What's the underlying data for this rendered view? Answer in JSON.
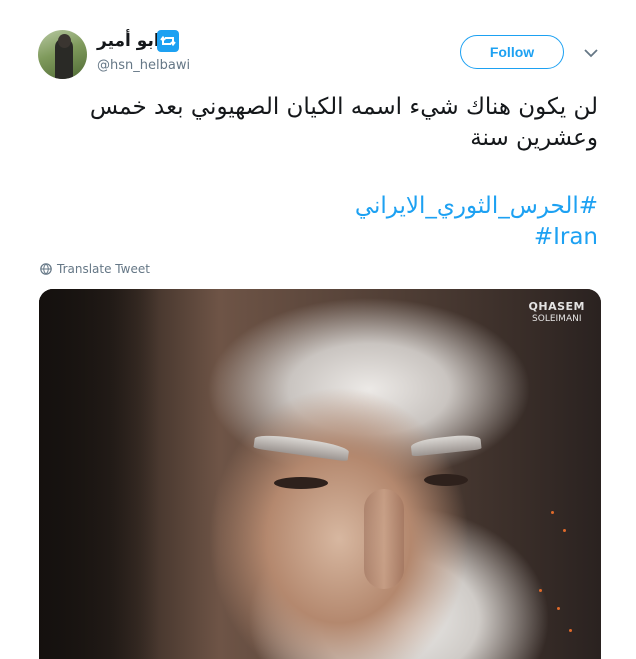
{
  "author": {
    "display_name": "ابو أمير",
    "handle": "@hsn_helbawi",
    "avatar_icon": "user-avatar-photo",
    "badge_icon": "retweet-icon"
  },
  "follow_button": {
    "label": "Follow"
  },
  "menu": {
    "icon": "chevron-down-icon"
  },
  "tweet": {
    "text": "لن يكون هناك شيء اسمه الكيان الصهيوني بعد خمس وعشرين سنة",
    "hashtags": [
      "#الحرس_الثوري_الايراني",
      "#Iran"
    ]
  },
  "translate": {
    "label": "Translate Tweet",
    "icon": "globe-icon"
  },
  "media": {
    "watermark_line1": "QHASEM",
    "watermark_line2": "SOLEIMANI"
  },
  "colors": {
    "accent": "#1da1f2",
    "text": "#14171a",
    "secondary": "#657786"
  }
}
